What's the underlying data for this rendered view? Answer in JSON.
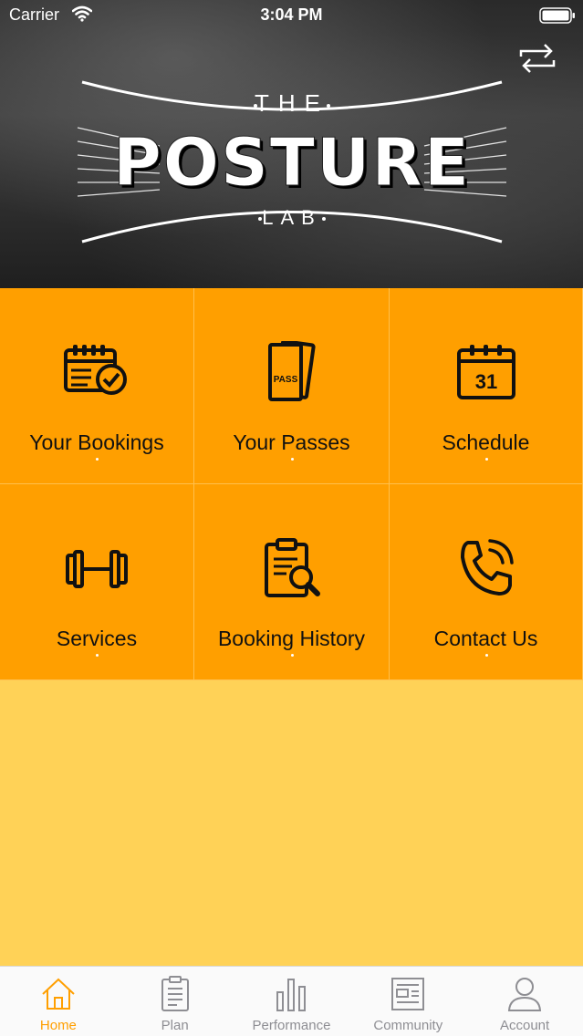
{
  "status_bar": {
    "carrier": "Carrier",
    "time": "3:04 PM"
  },
  "header": {
    "logo_top": "THE",
    "logo_main": "POSTURE",
    "logo_bottom": "LAB",
    "switch_icon": "repeat-arrows-icon"
  },
  "tiles": [
    {
      "label": "Your Bookings",
      "icon": "calendar-check-icon"
    },
    {
      "label": "Your Passes",
      "icon": "pass-tickets-icon"
    },
    {
      "label": "Schedule",
      "icon": "calendar-31-icon",
      "icon_text": "31"
    },
    {
      "label": "Services",
      "icon": "dumbbell-icon"
    },
    {
      "label": "Booking History",
      "icon": "clipboard-search-icon"
    },
    {
      "label": "Contact Us",
      "icon": "phone-ringing-icon"
    }
  ],
  "pass_icon_text": "PASS",
  "tabbar": {
    "items": [
      {
        "label": "Home",
        "icon": "home-icon",
        "active": true
      },
      {
        "label": "Plan",
        "icon": "clipboard-icon",
        "active": false
      },
      {
        "label": "Performance",
        "icon": "bar-chart-icon",
        "active": false
      },
      {
        "label": "Community",
        "icon": "newspaper-icon",
        "active": false
      },
      {
        "label": "Account",
        "icon": "user-icon",
        "active": false
      }
    ]
  },
  "colors": {
    "tile_bg": "#ff9f00",
    "page_bg": "#ffd257",
    "active_tab": "#ff9f00",
    "inactive_tab": "#8e8e93"
  }
}
